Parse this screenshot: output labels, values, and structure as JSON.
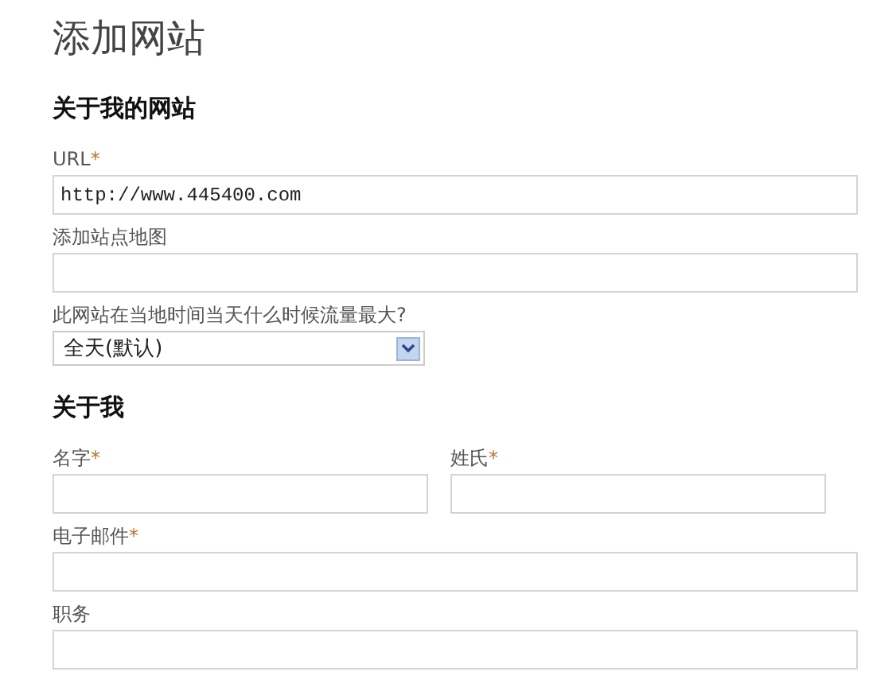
{
  "title": "添加网站",
  "sections": [
    {
      "heading": "关于我的网站",
      "fields": [
        {
          "kind": "full",
          "label": "URL",
          "required_mark": "*",
          "value": "http://www.445400.com"
        },
        {
          "kind": "full",
          "label": "添加站点地图"
        },
        {
          "kind": "select",
          "label": "此网站在当地时间当天什么时候流量最大?",
          "value": "全天(默认)"
        }
      ]
    },
    {
      "heading": "关于我",
      "fields": [
        {
          "kind": "half",
          "label": "名字",
          "required_mark": "*"
        },
        {
          "kind": "half",
          "label": "姓氏",
          "required_mark": "*"
        },
        {
          "kind": "full",
          "label": "电子邮件",
          "required_mark": "*"
        },
        {
          "kind": "full",
          "label": "职务"
        }
      ]
    }
  ]
}
